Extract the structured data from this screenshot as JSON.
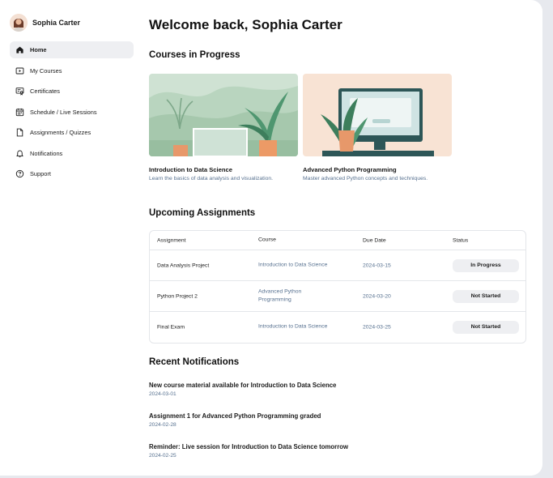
{
  "user": {
    "name": "Sophia Carter"
  },
  "nav": [
    {
      "label": "Home",
      "icon": "home-icon",
      "active": true
    },
    {
      "label": "My Courses",
      "icon": "play-box-icon",
      "active": false
    },
    {
      "label": "Certificates",
      "icon": "certificate-icon",
      "active": false
    },
    {
      "label": "Schedule / Live Sessions",
      "icon": "calendar-icon",
      "active": false
    },
    {
      "label": "Assignments / Quizzes",
      "icon": "document-icon",
      "active": false
    },
    {
      "label": "Notifications",
      "icon": "bell-icon",
      "active": false
    },
    {
      "label": "Support",
      "icon": "help-circle-icon",
      "active": false
    }
  ],
  "main": {
    "welcome": "Welcome back, Sophia Carter",
    "courses_title": "Courses in Progress",
    "courses": [
      {
        "title": "Introduction to Data Science",
        "description": "Learn the basics of data analysis and visualization."
      },
      {
        "title": "Advanced Python Programming",
        "description": "Master advanced Python concepts and techniques."
      }
    ],
    "assignments_title": "Upcoming Assignments",
    "assignments_headers": [
      "Assignment",
      "Course",
      "Due Date",
      "Status"
    ],
    "assignments": [
      {
        "name": "Data Analysis Project",
        "course": "Introduction to Data Science",
        "due": "2024-03-15",
        "status": "In Progress"
      },
      {
        "name": "Python Project 2",
        "course": "Advanced Python Programming",
        "due": "2024-03-20",
        "status": "Not Started"
      },
      {
        "name": "Final Exam",
        "course": "Introduction to Data Science",
        "due": "2024-03-25",
        "status": "Not Started"
      }
    ],
    "notifications_title": "Recent Notifications",
    "notifications": [
      {
        "text": "New course material available for Introduction to Data Science",
        "date": "2024-03-01"
      },
      {
        "text": "Assignment 1 for Advanced Python Programming graded",
        "date": "2024-02-28"
      },
      {
        "text": "Reminder: Live session for Introduction to Data Science tomorrow",
        "date": "2024-02-25"
      }
    ]
  },
  "colors": {
    "accent_text": "#56708f",
    "active_nav_bg": "#eeeff2",
    "badge_bg": "#eeeff2"
  }
}
